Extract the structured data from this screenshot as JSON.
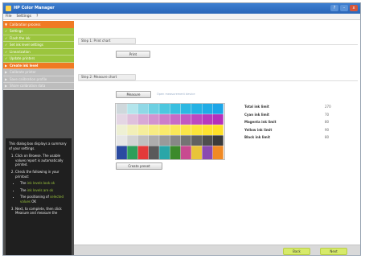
{
  "window": {
    "title": "HP Color Manager",
    "controls": [
      "?",
      "-",
      "x"
    ]
  },
  "menubar": {
    "items": [
      "File",
      "Settings",
      "?"
    ]
  },
  "sidebar": {
    "header": "Calibration process",
    "items": [
      {
        "label": "Settings",
        "state": "done"
      },
      {
        "label": "Flash the ink",
        "state": "done"
      },
      {
        "label": "Set ink level settings",
        "state": "done"
      },
      {
        "label": "Linearization",
        "state": "done"
      },
      {
        "label": "Update printers",
        "state": "done"
      },
      {
        "label": "Create ink level",
        "state": "active"
      },
      {
        "label": "Calibrate printer",
        "state": "future"
      },
      {
        "label": "Save calibration profile",
        "state": "future"
      },
      {
        "label": "Share calibration data",
        "state": "future"
      }
    ],
    "help": {
      "intro": "This dialog box displays a summary of your settings.",
      "steps": [
        "Click on Browse. The usable values report is automatically printed.",
        "Check the following in your printout:",
        "Next, to complete, then click Measure and measure the"
      ],
      "bullets": [
        {
          "prefix": "The ",
          "highlight": "ink levels look ok",
          "suffix": ""
        },
        {
          "prefix": "The ",
          "highlight": "ink levels are ok",
          "suffix": ""
        },
        {
          "prefix": "The positioning of ",
          "highlight": "selected values",
          "suffix": " OK"
        }
      ]
    }
  },
  "main": {
    "step1": {
      "label": "Step 1: Print chart",
      "button": "Print"
    },
    "step2": {
      "label": "Step 2: Measure chart",
      "measure_button": "Measure",
      "hint": "Open measurement device",
      "create_button": "Create preset"
    },
    "levels": [
      {
        "label": "Total ink limit",
        "value": "270"
      },
      {
        "label": "Cyan ink limit",
        "value": "70"
      },
      {
        "label": "Magenta ink limit",
        "value": "80"
      },
      {
        "label": "Yellow ink limit",
        "value": "90"
      },
      {
        "label": "Black ink limit",
        "value": "80"
      }
    ],
    "chart_colors": {
      "rows": [
        [
          "#cfd8dc",
          "#b3e5ec",
          "#8fd8e6",
          "#6cd0e2",
          "#4cc7df",
          "#38bfe0",
          "#2cb8e2",
          "#24b2e4",
          "#20ace6",
          "#1ca5e8"
        ],
        [
          "#e4d6e4",
          "#dfc0dc",
          "#d8a8d6",
          "#d293d0",
          "#cc7eca",
          "#c76bc6",
          "#c259c3",
          "#bd48c0",
          "#b83abe",
          "#b52fbc"
        ],
        [
          "#eef0d4",
          "#f2efb8",
          "#f5ee9c",
          "#f7ec84",
          "#f9ea6c",
          "#fae858",
          "#fbe648",
          "#fce43a",
          "#fde230",
          "#fee028"
        ],
        [
          "#e6e6e6",
          "#d3d3d3",
          "#c0c0c0",
          "#adadad",
          "#9a9a9a",
          "#878787",
          "#747474",
          "#616161",
          "#4e4e4e",
          "#3b3b3b"
        ]
      ],
      "bottom_row": [
        "#2a4aa0",
        "#2e9e5a",
        "#e33a3a",
        "#5a5a5a",
        "#2aa6a8",
        "#3c8a2c",
        "#c84a90",
        "#e8c43a",
        "#8a4ab0",
        "#f08a24"
      ]
    }
  },
  "footer": {
    "back": "Back",
    "next": "Next"
  },
  "colors": {
    "accent": "#f07a24",
    "done": "#9bc53d",
    "titlebar": "#2f6fc4",
    "nav_button": "#d6ea6a"
  },
  "icons": [
    "app-icon",
    "help-icon",
    "minimize-icon",
    "close-icon",
    "check-icon",
    "expand-icon"
  ]
}
